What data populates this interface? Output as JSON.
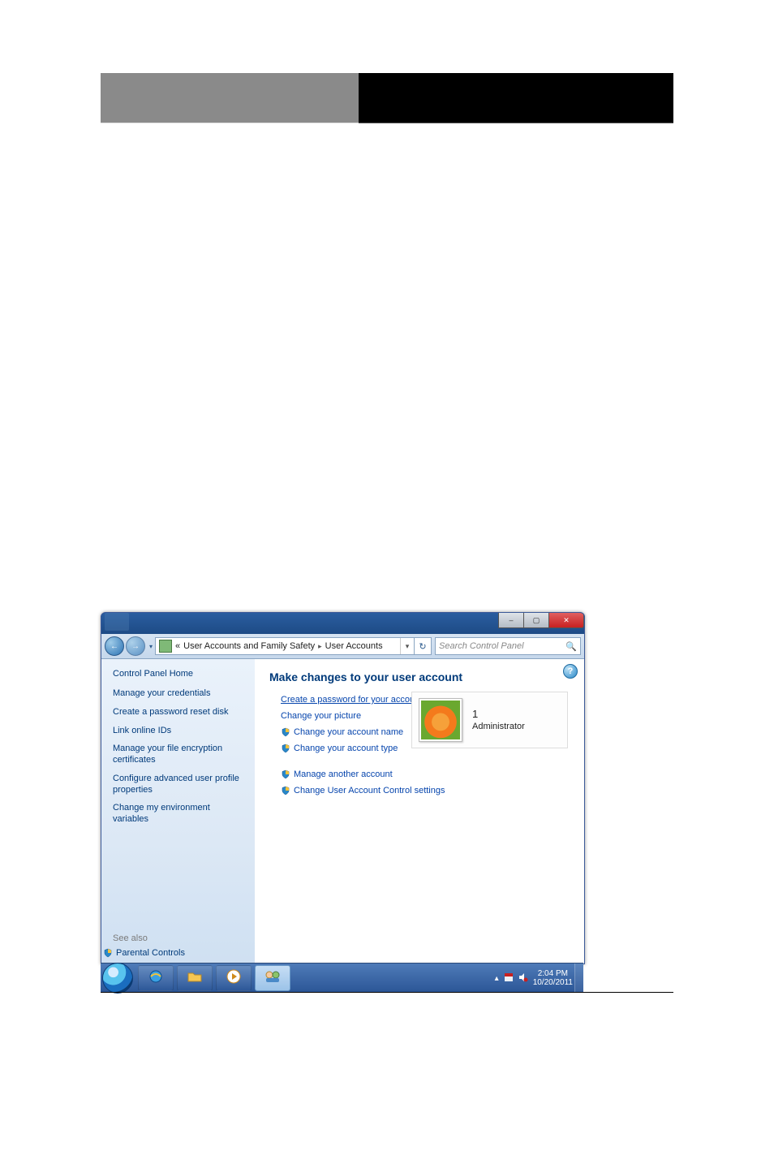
{
  "header": {},
  "window": {
    "caption_buttons": {
      "min": "–",
      "max": "▢",
      "close": "✕"
    },
    "nav": {
      "back_glyph": "←",
      "forward_glyph": "→",
      "dropdown_glyph": "▾",
      "breadcrumb_prefix": "«",
      "crumb1": "User Accounts and Family Safety",
      "crumb_sep": "▸",
      "crumb2": "User Accounts",
      "addr_drop_glyph": "▾",
      "refresh_glyph": "↻"
    },
    "search": {
      "placeholder": "Search Control Panel",
      "icon_glyph": "🔍"
    },
    "sidebar": {
      "home": "Control Panel Home",
      "tasks": [
        "Manage your credentials",
        "Create a password reset disk",
        "Link online IDs",
        "Manage your file encryption certificates",
        "Configure advanced user profile properties",
        "Change my environment variables"
      ],
      "see_also_label": "See also",
      "see_also_link": "Parental Controls"
    },
    "main": {
      "help_glyph": "?",
      "title": "Make changes to your user account",
      "options_a": [
        {
          "label": "Create a password for your account",
          "shield": false,
          "underline": true
        },
        {
          "label": "Change your picture",
          "shield": false,
          "underline": false
        },
        {
          "label": "Change your account name",
          "shield": true,
          "underline": false
        },
        {
          "label": "Change your account type",
          "shield": true,
          "underline": false
        }
      ],
      "options_b": [
        {
          "label": "Manage another account",
          "shield": true
        },
        {
          "label": "Change User Account Control settings",
          "shield": true
        }
      ],
      "account": {
        "name": "1",
        "role": "Administrator"
      }
    }
  },
  "taskbar": {
    "tray_up_glyph": "▴",
    "time": "2:04 PM",
    "date": "10/20/2011"
  }
}
